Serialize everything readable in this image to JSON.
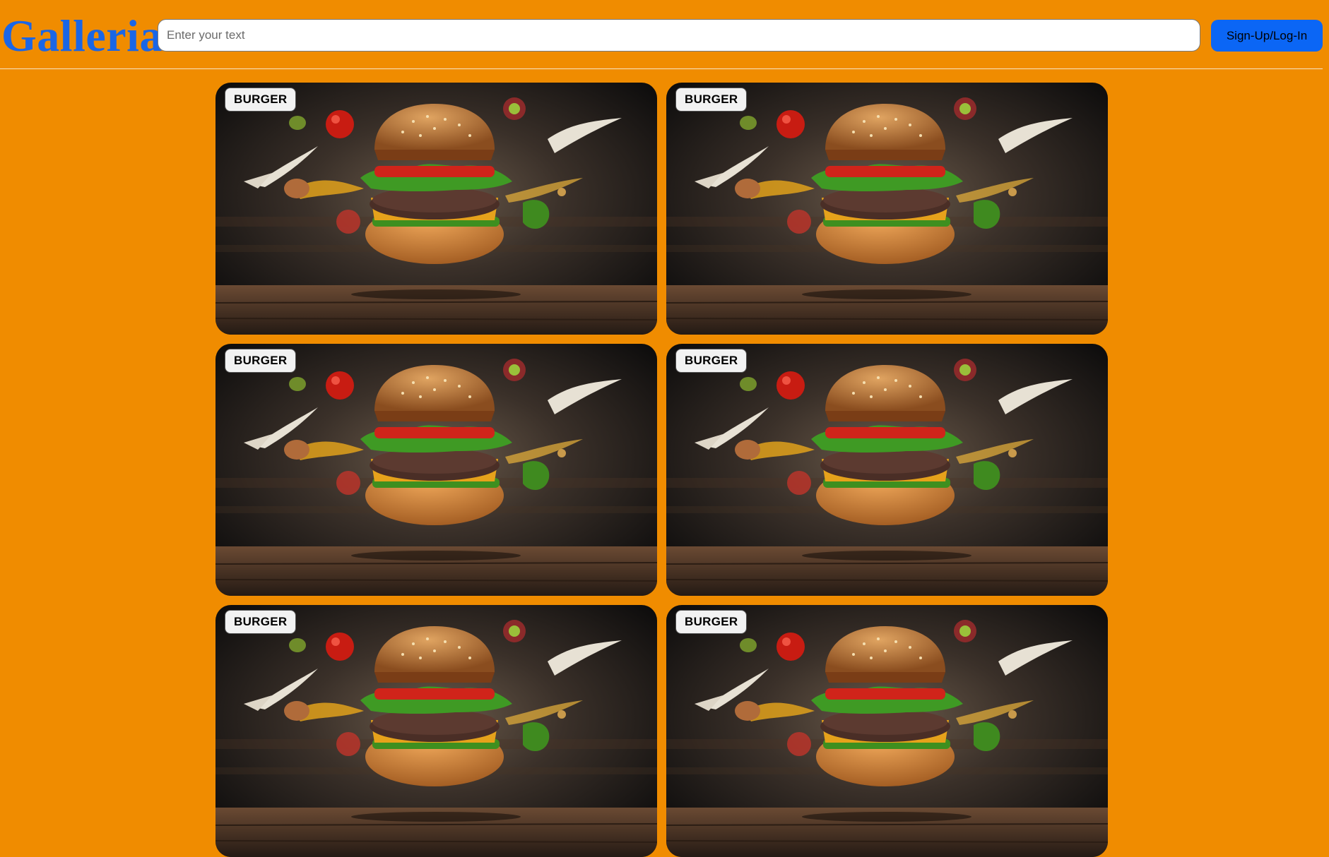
{
  "header": {
    "logo": "Galleria",
    "search_placeholder": "Enter your text",
    "search_value": "",
    "auth_button": "Sign-Up/Log-In"
  },
  "colors": {
    "background": "#f08c00",
    "logo": "#1a66e6",
    "button": "#0b66f5"
  },
  "cards": [
    {
      "label": "BURGER",
      "image": "burger-image"
    },
    {
      "label": "BURGER",
      "image": "burger-image"
    },
    {
      "label": "BURGER",
      "image": "burger-image"
    },
    {
      "label": "BURGER",
      "image": "burger-image"
    },
    {
      "label": "BURGER",
      "image": "burger-image"
    },
    {
      "label": "BURGER",
      "image": "burger-image"
    }
  ]
}
